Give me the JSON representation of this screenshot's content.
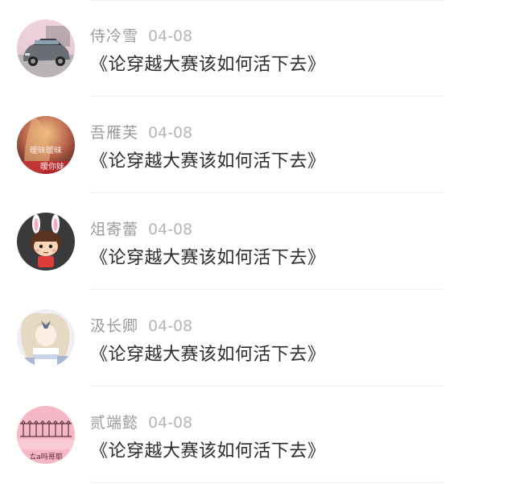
{
  "comments": [
    {
      "name": "侍冷雪",
      "date": "04-08",
      "text": "《论穿越大赛该如何活下去》",
      "avatar": "car-avatar"
    },
    {
      "name": "吾雁芙",
      "date": "04-08",
      "text": "《论穿越大赛该如何活下去》",
      "avatar": "girl-text-avatar",
      "avatar_text": [
        "暧昧暧昧",
        "暧你妹"
      ]
    },
    {
      "name": "俎寄蕾",
      "date": "04-08",
      "text": "《论穿越大赛该如何活下去》",
      "avatar": "bunny-cartoon-avatar"
    },
    {
      "name": "汲长卿",
      "date": "04-08",
      "text": "《论穿越大赛该如何活下去》",
      "avatar": "anime-girl-avatar"
    },
    {
      "name": "贰端懿",
      "date": "04-08",
      "text": "《论穿越大赛该如何活下去》",
      "avatar": "pink-pattern-avatar",
      "avatar_text": [
        "ㄊa吗哥耶"
      ]
    }
  ]
}
